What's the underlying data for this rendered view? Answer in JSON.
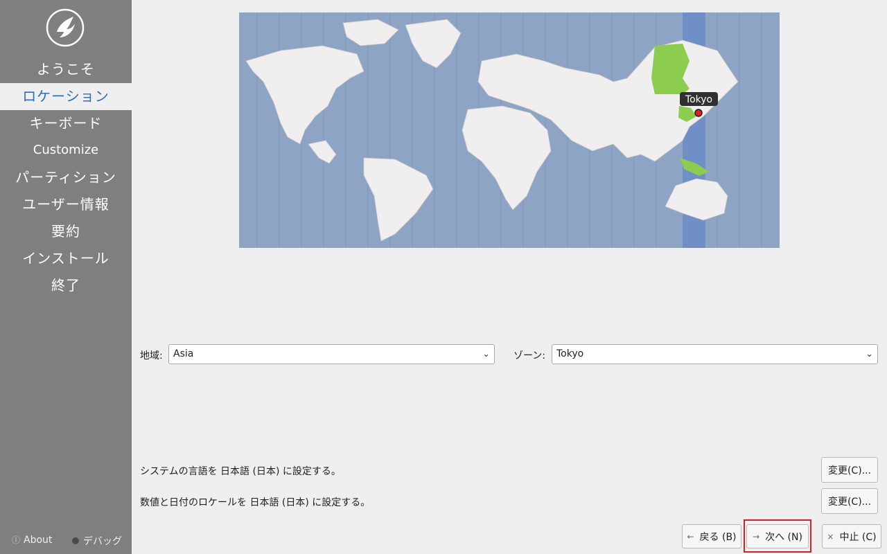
{
  "sidebar": {
    "items": [
      {
        "label": "ようこそ",
        "active": false
      },
      {
        "label": "ロケーション",
        "active": true
      },
      {
        "label": "キーボード",
        "active": false
      },
      {
        "label": "Customize",
        "active": false
      },
      {
        "label": "パーティション",
        "active": false
      },
      {
        "label": "ユーザー情報",
        "active": false
      },
      {
        "label": "要約",
        "active": false
      },
      {
        "label": "インストール",
        "active": false
      },
      {
        "label": "終了",
        "active": false
      }
    ],
    "about_label": "About",
    "debug_label": "デバッグ"
  },
  "map": {
    "marker_label": "Tokyo",
    "colors": {
      "ocean": "#8da4c4",
      "land": "#f0eeee",
      "zone_band": "#6f8fc6",
      "zone_land": "#8ccc4e",
      "marker": "#e02020"
    }
  },
  "region": {
    "label": "地域:",
    "value": "Asia"
  },
  "zone": {
    "label": "ゾーン:",
    "value": "Tokyo"
  },
  "info": {
    "language_text": "システムの言語を 日本語 (日本) に設定する。",
    "locale_text": "数値と日付のロケールを 日本語 (日本) に設定する。",
    "change_label": "変更(C)..."
  },
  "buttons": {
    "back": "戻る (B)",
    "next": "次へ (N)",
    "cancel": "中止 (C)"
  },
  "accent_color": "#2a6ebc"
}
